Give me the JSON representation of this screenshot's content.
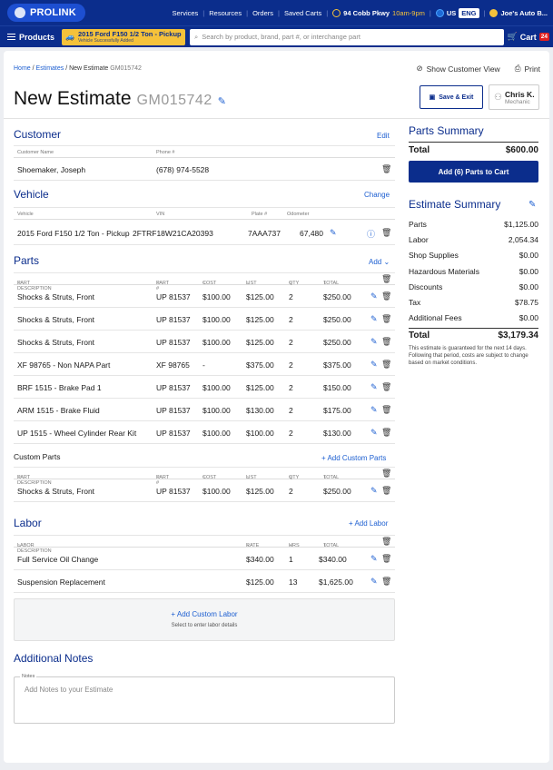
{
  "topbar": {
    "logo": "PROLINK",
    "nav": [
      "Services",
      "Resources",
      "Orders",
      "Saved Carts"
    ],
    "store_name": "94 Cobb Pkwy",
    "store_hours": "10am-9pm",
    "country": "US",
    "language": "ENG",
    "account": "Joe's Auto B..."
  },
  "subbar": {
    "products_label": "Products",
    "vehicle_title": "2015 Ford F150 1/2 Ton - Pickup",
    "vehicle_status": "Vehicle Successfully Added",
    "search_placeholder": "Search by product, brand, part #, or interchange part",
    "cart_label": "Cart",
    "cart_count": "24"
  },
  "breadcrumb": {
    "home": "Home",
    "estimates": "Estimates",
    "current": "New Estimate",
    "id": "GM015742"
  },
  "header_links": {
    "show_customer": "Show Customer View",
    "print": "Print"
  },
  "page_title": {
    "label": "New Estimate",
    "number": "GM015742"
  },
  "save_exit": "Save & Exit",
  "user": {
    "name": "Chris K.",
    "role": "Mechanic"
  },
  "customer": {
    "title": "Customer",
    "edit": "Edit",
    "col_name": "Customer Name",
    "col_phone": "Phone #",
    "name": "Shoemaker, Joseph",
    "phone": "(678) 974-5528"
  },
  "vehicle": {
    "title": "Vehicle",
    "change": "Change",
    "col_vehicle": "Vehicle",
    "col_vin": "VIN",
    "col_plate": "Plate #",
    "col_odo": "Odometer",
    "vehicle": "2015 Ford F150 1/2 Ton - Pickup",
    "vin": "2FTRF18W21CA20393",
    "plate": "7AAA737",
    "odometer": "67,480"
  },
  "parts": {
    "title": "Parts",
    "add": "Add",
    "cols": [
      "Part Description",
      "Part #",
      "Cost",
      "List",
      "QTY",
      "Total"
    ],
    "rows": [
      [
        "Shocks & Struts, Front",
        "UP 81537",
        "$100.00",
        "$125.00",
        "2",
        "$250.00"
      ],
      [
        "Shocks & Struts, Front",
        "UP 81537",
        "$100.00",
        "$125.00",
        "2",
        "$250.00"
      ],
      [
        "Shocks & Struts, Front",
        "UP 81537",
        "$100.00",
        "$125.00",
        "2",
        "$250.00"
      ],
      [
        "XF 98765 - Non NAPA Part",
        "XF 98765",
        "-",
        "$375.00",
        "2",
        "$375.00"
      ],
      [
        "BRF 1515 - Brake Pad 1",
        "UP 81537",
        "$100.00",
        "$125.00",
        "2",
        "$150.00"
      ],
      [
        "ARM 1515 - Brake Fluid",
        "UP 81537",
        "$100.00",
        "$130.00",
        "2",
        "$175.00"
      ],
      [
        "UP 1515 - Wheel Cylinder Rear Kit",
        "UP 81537",
        "$100.00",
        "$100.00",
        "2",
        "$130.00"
      ]
    ]
  },
  "custom_parts": {
    "title": "Custom Parts",
    "add": "+ Add Custom Parts",
    "rows": [
      [
        "Shocks & Struts, Front",
        "UP 81537",
        "$100.00",
        "$125.00",
        "2",
        "$250.00"
      ]
    ]
  },
  "labor": {
    "title": "Labor",
    "add": "+ Add Labor",
    "cols": [
      "Labor Description",
      "Rate",
      "HRS",
      "Total"
    ],
    "rows": [
      [
        "Full Service Oil Change",
        "$340.00",
        "1",
        "$340.00"
      ],
      [
        "Suspension Replacement",
        "$125.00",
        "13",
        "$1,625.00"
      ]
    ],
    "custom_add": "+ Add Custom Labor",
    "custom_hint": "Select to enter labor details"
  },
  "notes": {
    "title": "Additional Notes",
    "label": "Notes",
    "placeholder": "Add Notes to your Estimate"
  },
  "parts_summary": {
    "title": "Parts Summary",
    "total_label": "Total",
    "total": "$600.00",
    "add_to_cart": "Add (6) Parts to Cart"
  },
  "estimate_summary": {
    "title": "Estimate Summary",
    "rows": [
      [
        "Parts",
        "$1,125.00"
      ],
      [
        "Labor",
        "2,054.34"
      ],
      [
        "Shop Supplies",
        "$0.00"
      ],
      [
        "Hazardous Materials",
        "$0.00"
      ],
      [
        "Discounts",
        "$0.00"
      ],
      [
        "Tax",
        "$78.75"
      ],
      [
        "Additional Fees",
        "$0.00"
      ]
    ],
    "total_label": "Total",
    "total": "$3,179.34",
    "guarantee": "This estimate is guaranteed for the next 14 days. Following that period, costs are subject to change based on market conditions."
  }
}
